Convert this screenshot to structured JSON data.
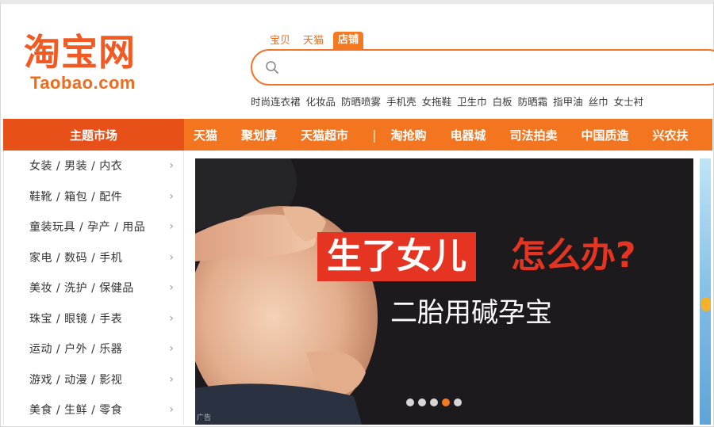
{
  "logo": {
    "cn": "淘宝网",
    "en": "Taobao.com"
  },
  "search": {
    "tabs": [
      {
        "label": "宝贝",
        "active": false
      },
      {
        "label": "天猫",
        "active": false
      },
      {
        "label": "店铺",
        "active": true
      }
    ],
    "value": "",
    "placeholder": ""
  },
  "hot_words": [
    "时尚连衣裙",
    "化妆品",
    "防晒喷雾",
    "手机壳",
    "女拖鞋",
    "卫生巾",
    "白板",
    "防晒霜",
    "指甲油",
    "丝巾",
    "女士衬"
  ],
  "nav": {
    "theme_label": "主题市场",
    "items": [
      "天猫",
      "聚划算",
      "天猫超市"
    ],
    "separator": "|",
    "items2": [
      "淘抢购",
      "电器城",
      "司法拍卖",
      "中国质造",
      "兴农扶"
    ]
  },
  "sidebar": {
    "items": [
      "女装 / 男装 / 内衣",
      "鞋靴 / 箱包 / 配件",
      "童装玩具 / 孕产 / 用品",
      "家电 / 数码 / 手机",
      "美妆 / 洗护 / 保健品",
      "珠宝 / 眼镜 / 手表",
      "运动 / 户外 / 乐器",
      "游戏 / 动漫 / 影视",
      "美食 / 生鲜 / 零食"
    ],
    "arrow": "›"
  },
  "banner": {
    "title_red": "生了女儿",
    "title_rest": "怎么办?",
    "subtitle": "二胎用碱孕宝",
    "ad_tag": "广告",
    "dots_count": 5,
    "active_dot": 3
  },
  "colors": {
    "brand_orange": "#f4751f",
    "accent_red": "#e53522"
  }
}
